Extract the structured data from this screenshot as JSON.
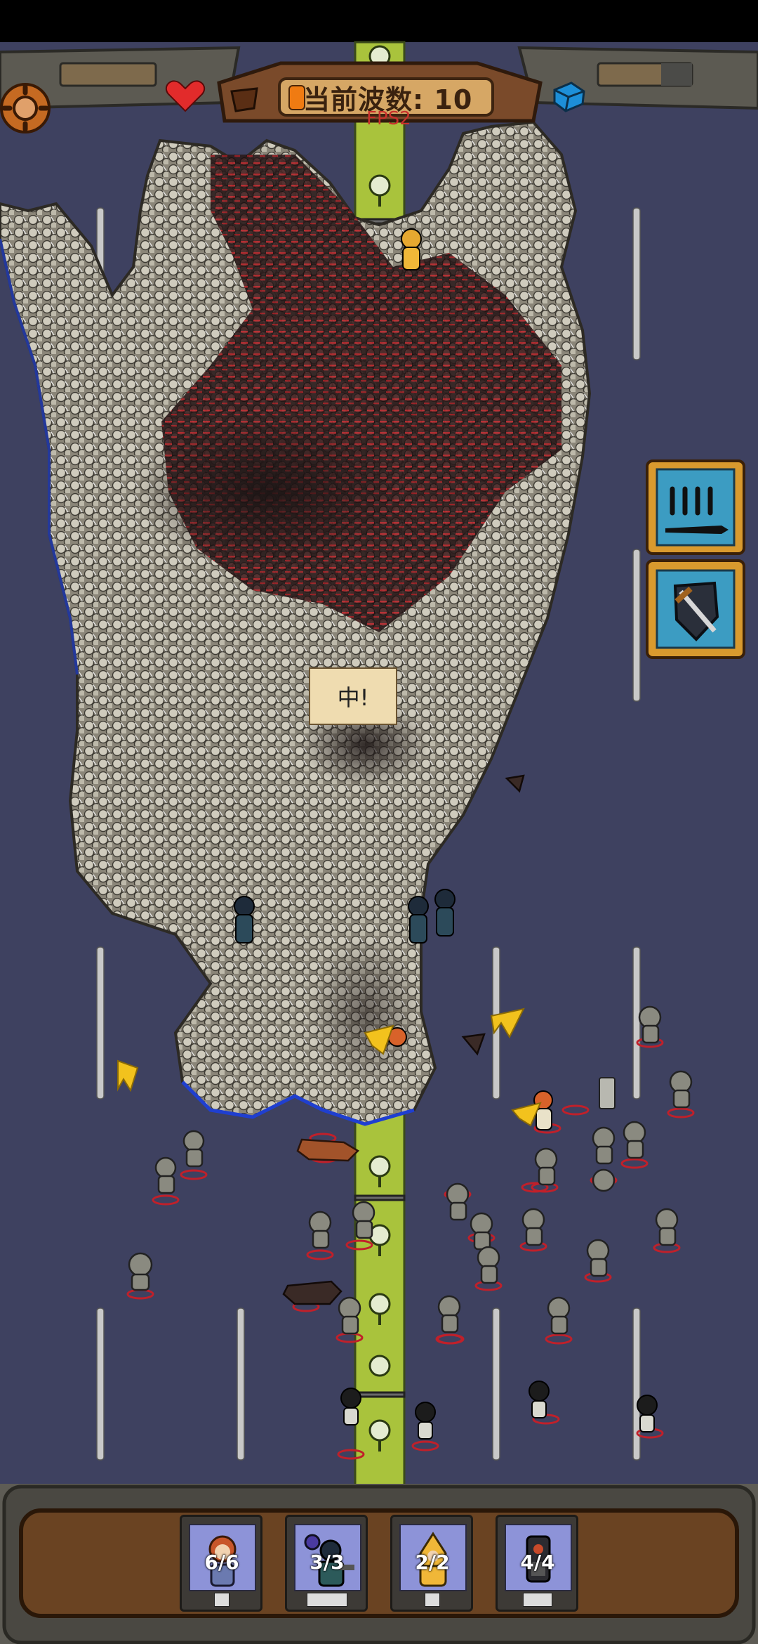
{
  "hud": {
    "wave_label": "当前波数: 10",
    "fps_label": "FPS2",
    "settings_icon": "gear-icon",
    "health_icon": "heart-icon",
    "resource_icon": "blue-cube-icon"
  },
  "speech_bubble": "中!",
  "side_buttons": [
    {
      "name": "sword-barrage-skill",
      "icon": "swords-icon"
    },
    {
      "name": "sword-shield-skill",
      "icon": "sword-shield-icon"
    }
  ],
  "units": [
    {
      "name": "unit-card-archer",
      "count": "6/6",
      "icon": "orange-hair-girl"
    },
    {
      "name": "unit-card-mage",
      "count": "3/3",
      "icon": "dark-mage"
    },
    {
      "name": "unit-card-monk",
      "count": "2/2",
      "icon": "yellow-hood"
    },
    {
      "name": "unit-card-tank",
      "count": "4/4",
      "icon": "dark-knight"
    }
  ],
  "colors": {
    "road": "#3e4160",
    "median": "#a9c33c",
    "hud_wood": "#7a4a2a",
    "panel_bg": "#6a4322",
    "frame_gold": "#d79b2c"
  }
}
